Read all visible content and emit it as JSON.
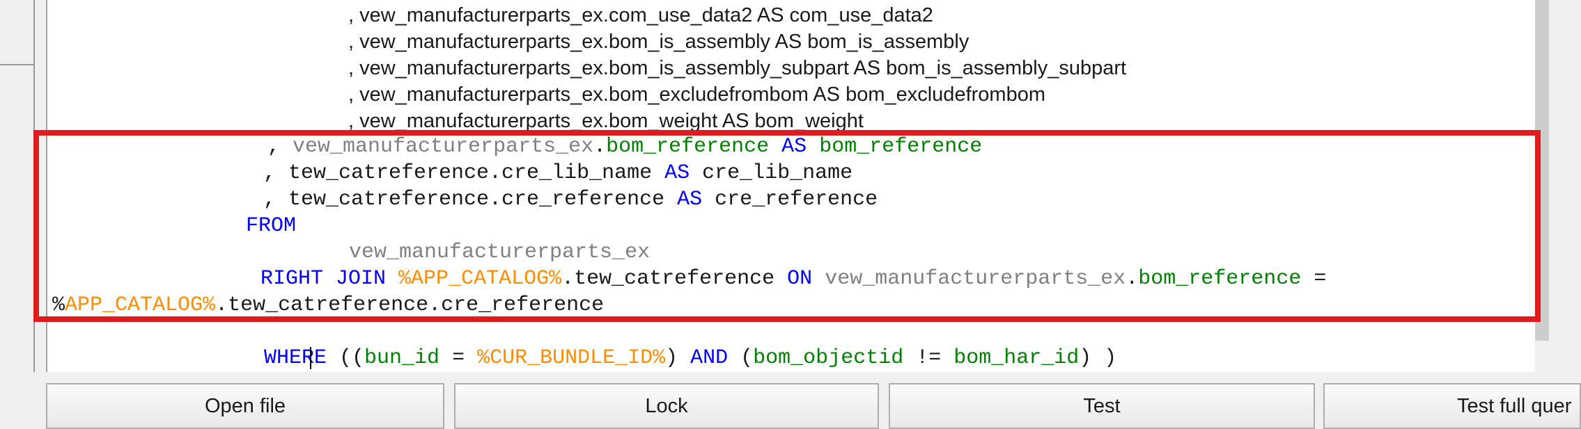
{
  "editor": {
    "upper_lines": [
      ", vew_manufacturerparts_ex.com_use_data2 AS com_use_data2",
      ", vew_manufacturerparts_ex.bom_is_assembly AS bom_is_assembly",
      ", vew_manufacturerparts_ex.bom_is_assembly_subpart AS bom_is_assembly_subpart",
      ", vew_manufacturerparts_ex.bom_excludefrombom AS bom_excludefrombom",
      ", vew_manufacturerparts_ex.bom_weight AS bom_weight"
    ],
    "line6": {
      "comma": ", ",
      "view": "vew_manufacturerparts_ex",
      "dot": ".",
      "column": "bom_reference",
      "as": "AS",
      "alias": "bom_reference"
    },
    "line7": {
      "prefix": ", tew_catreference.cre_lib_name ",
      "as": "AS",
      "alias": " cre_lib_name"
    },
    "line8": {
      "prefix": ", tew_catreference.cre_reference ",
      "as": "AS",
      "alias": " cre_reference"
    },
    "line9": {
      "from": "FROM"
    },
    "line10": {
      "view": "vew_manufacturerparts_ex"
    },
    "line11": {
      "right_join": "RIGHT JOIN",
      "catalog": "%APP_CATALOG%",
      "table": ".tew_catreference ",
      "on": "ON",
      "view": "vew_manufacturerparts_ex",
      "dot": ".",
      "column": "bom_reference",
      "eq": " ="
    },
    "line12": {
      "percent": "%",
      "catalog": "APP_CATALOG%",
      "rest": ".tew_catreference.cre_reference"
    },
    "line13": {
      "where": "WHERE",
      "open": " ((",
      "bun_id": "bun_id",
      "eq": " = ",
      "cur_bundle": "%CUR_BUNDLE_ID%",
      "close1": ") ",
      "and": "AND",
      "open2": " (",
      "bom_objectid": "bom_objectid",
      "neq": " != ",
      "bom_har_id": "bom_har_id",
      "close2": ") )"
    }
  },
  "buttons": {
    "open_file": "Open file",
    "lock": "Lock",
    "test": "Test",
    "test_full_query": "Test full quer"
  },
  "colors": {
    "keyword": "#0000ff",
    "view_name": "#808080",
    "column": "#008000",
    "variable": "#ff8c00",
    "highlight_border": "#e01b1b"
  }
}
